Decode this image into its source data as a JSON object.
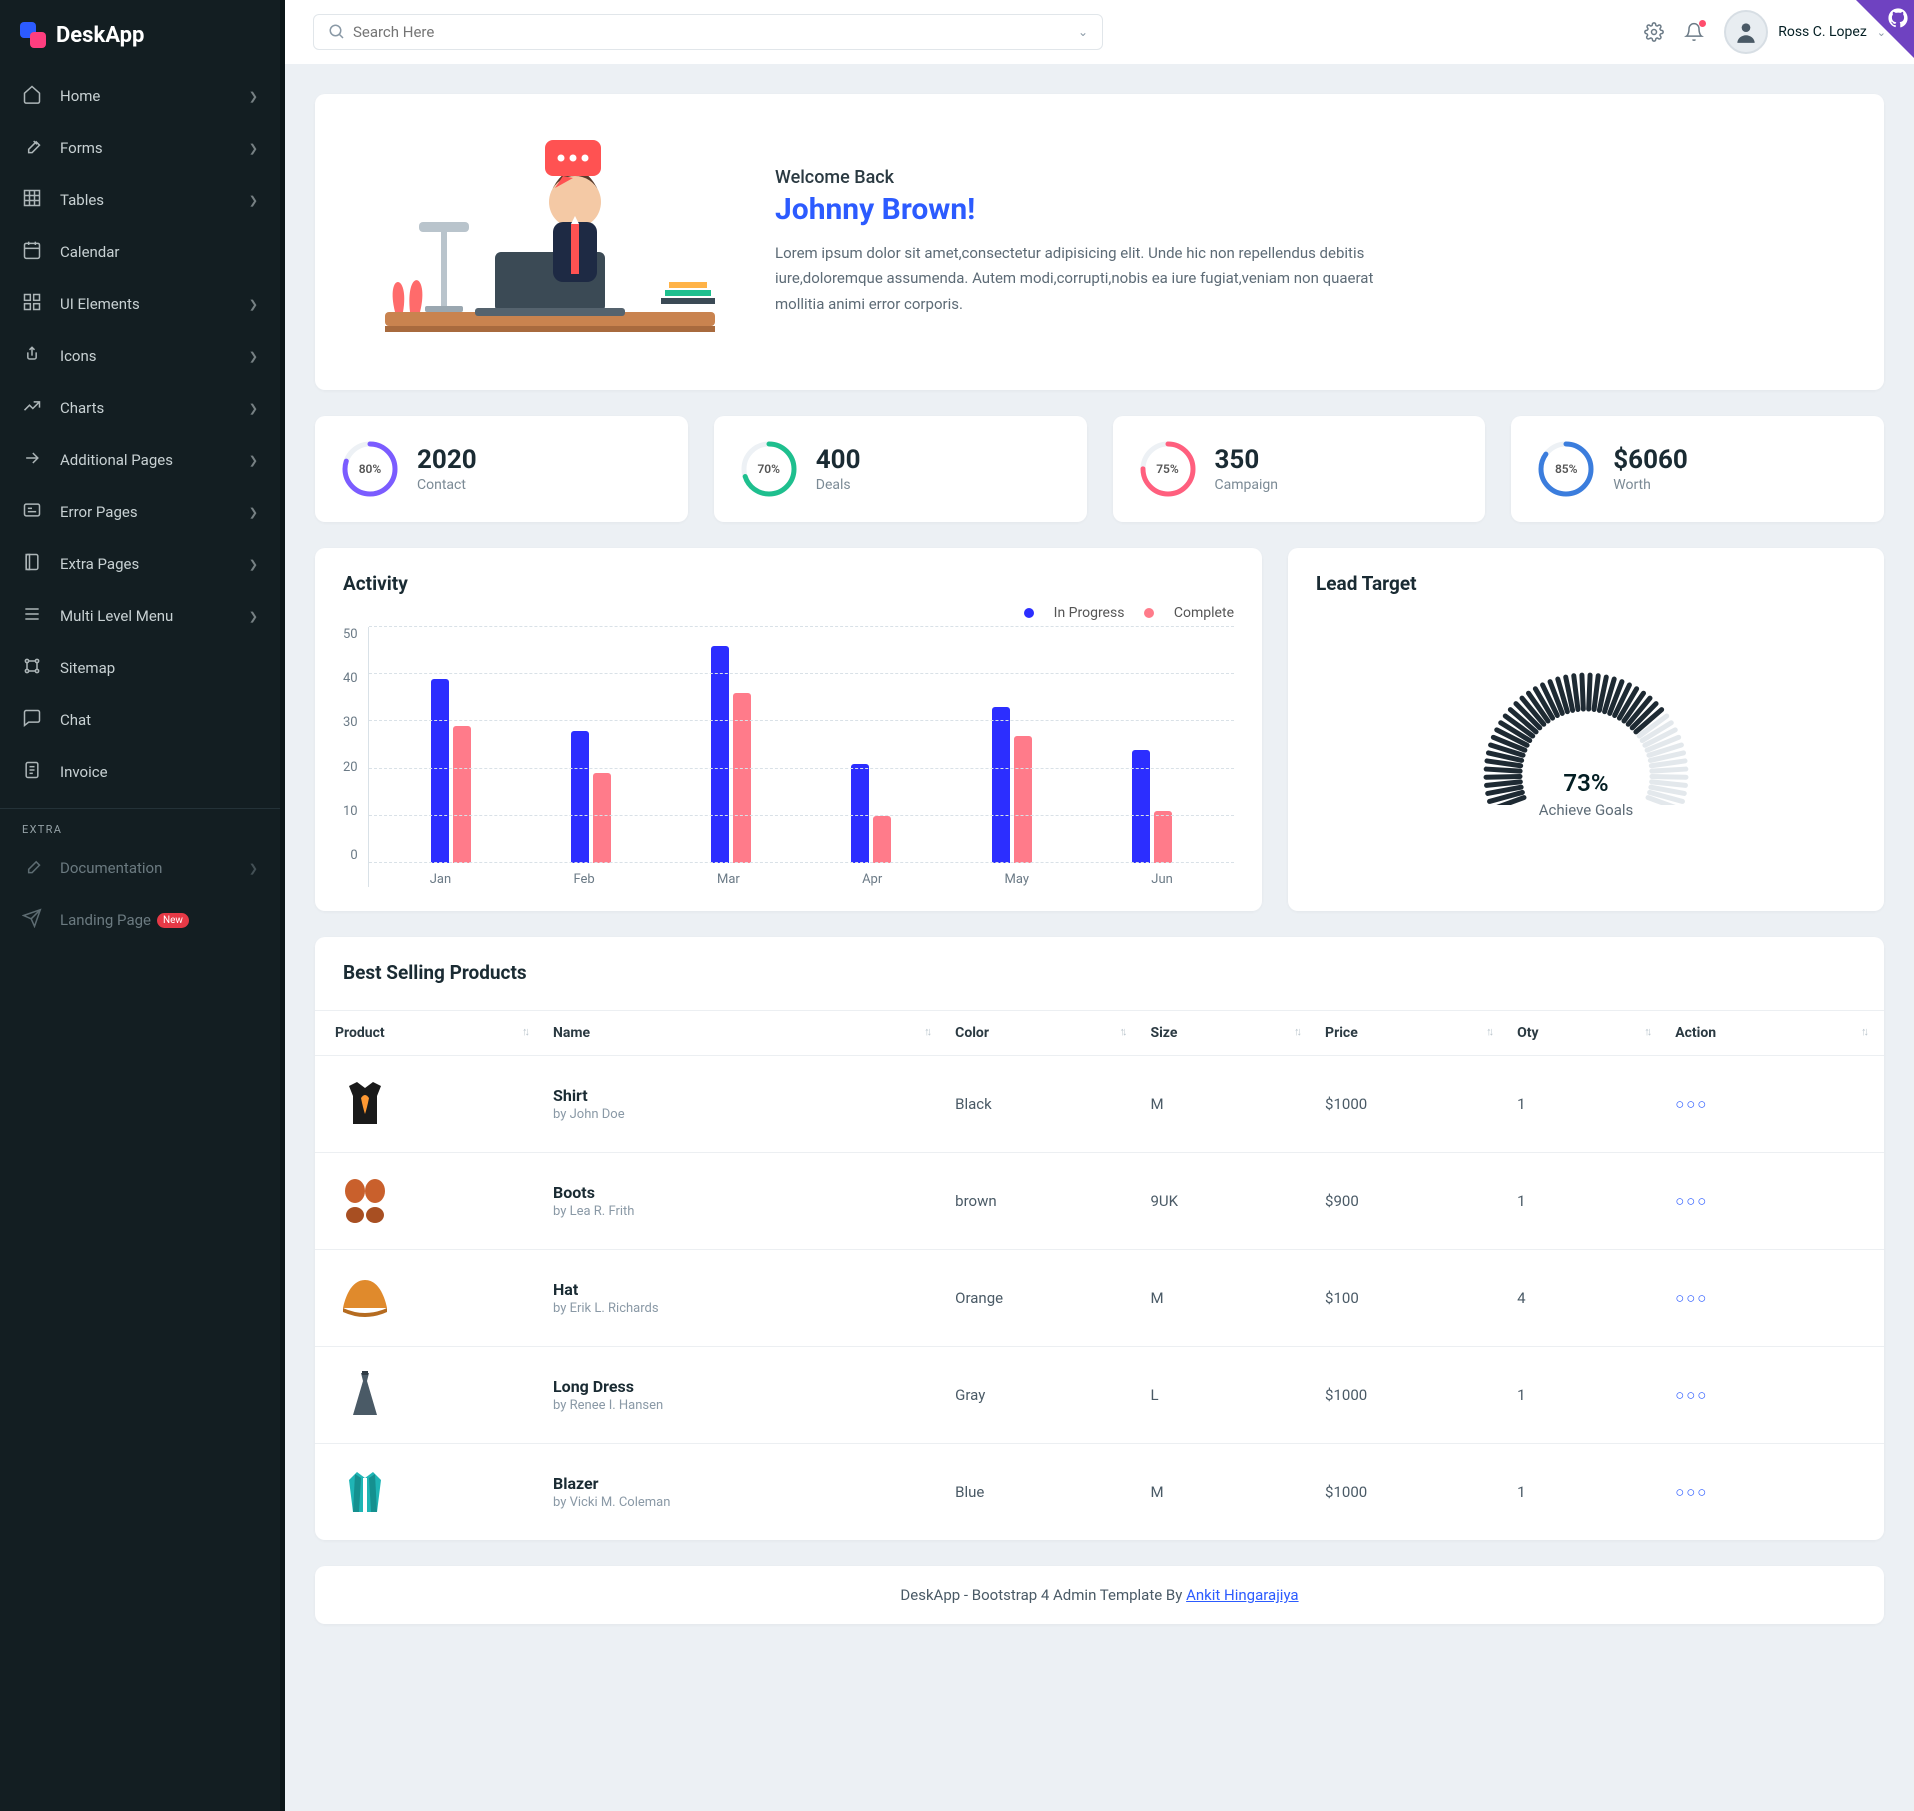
{
  "brand": "DeskApp",
  "search": {
    "placeholder": "Search Here"
  },
  "user": {
    "name": "Ross C. Lopez"
  },
  "sidebar": {
    "items": [
      {
        "label": "Home",
        "chev": true
      },
      {
        "label": "Forms",
        "chev": true
      },
      {
        "label": "Tables",
        "chev": true
      },
      {
        "label": "Calendar",
        "chev": false
      },
      {
        "label": "UI Elements",
        "chev": true
      },
      {
        "label": "Icons",
        "chev": true
      },
      {
        "label": "Charts",
        "chev": true
      },
      {
        "label": "Additional Pages",
        "chev": true
      },
      {
        "label": "Error Pages",
        "chev": true
      },
      {
        "label": "Extra Pages",
        "chev": true
      },
      {
        "label": "Multi Level Menu",
        "chev": true
      },
      {
        "label": "Sitemap",
        "chev": false
      },
      {
        "label": "Chat",
        "chev": false
      },
      {
        "label": "Invoice",
        "chev": false
      }
    ],
    "extra_header": "EXTRA",
    "extra": [
      {
        "label": "Documentation",
        "chev": true
      },
      {
        "label": "Landing Page"
      }
    ]
  },
  "welcome": {
    "small": "Welcome Back",
    "name": "Johnny Brown!",
    "body": "Lorem ipsum dolor sit amet,consectetur adipisicing elit. Unde hic non repellendus debitis iure,doloremque assumenda. Autem modi,corrupti,nobis ea iure fugiat,veniam non quaerat mollitia animi error corporis."
  },
  "stats": [
    {
      "pct": "80%",
      "p": 80,
      "value": "2020",
      "label": "Contact",
      "color": "#7b5cff"
    },
    {
      "pct": "70%",
      "p": 70,
      "value": "400",
      "label": "Deals",
      "color": "#1ebf8e"
    },
    {
      "pct": "75%",
      "p": 75,
      "value": "350",
      "label": "Campaign",
      "color": "#ff5f7e"
    },
    {
      "pct": "85%",
      "p": 85,
      "value": "$6060",
      "label": "Worth",
      "color": "#3b7ddd"
    }
  ],
  "activity": {
    "title": "Activity",
    "legend": {
      "a": "In Progress",
      "b": "Complete"
    }
  },
  "chart_data": {
    "type": "bar",
    "categories": [
      "Jan",
      "Feb",
      "Mar",
      "Apr",
      "May",
      "Jun"
    ],
    "series": [
      {
        "name": "In Progress",
        "values": [
          39,
          28,
          46,
          21,
          33,
          24
        ]
      },
      {
        "name": "Complete",
        "values": [
          29,
          19,
          36,
          10,
          27,
          11
        ]
      }
    ],
    "ylim": [
      0,
      50
    ],
    "yticks": [
      0,
      10,
      20,
      30,
      40,
      50
    ]
  },
  "lead": {
    "title": "Lead Target",
    "value": "73%",
    "pct": 73,
    "label": "Achieve Goals"
  },
  "products": {
    "title": "Best Selling Products",
    "columns": [
      "Product",
      "Name",
      "Color",
      "Size",
      "Price",
      "Oty",
      "Action"
    ],
    "rows": [
      {
        "name": "Shirt",
        "by": "by John Doe",
        "color": "Black",
        "size": "M",
        "price": "$1000",
        "qty": "1"
      },
      {
        "name": "Boots",
        "by": "by Lea R. Frith",
        "color": "brown",
        "size": "9UK",
        "price": "$900",
        "qty": "1"
      },
      {
        "name": "Hat",
        "by": "by Erik L. Richards",
        "color": "Orange",
        "size": "M",
        "price": "$100",
        "qty": "4"
      },
      {
        "name": "Long Dress",
        "by": "by Renee I. Hansen",
        "color": "Gray",
        "size": "L",
        "price": "$1000",
        "qty": "1"
      },
      {
        "name": "Blazer",
        "by": "by Vicki M. Coleman",
        "color": "Blue",
        "size": "M",
        "price": "$1000",
        "qty": "1"
      }
    ]
  },
  "footer": {
    "text": "DeskApp - Bootstrap 4 Admin Template By ",
    "link": "Ankit Hingarajiya"
  }
}
